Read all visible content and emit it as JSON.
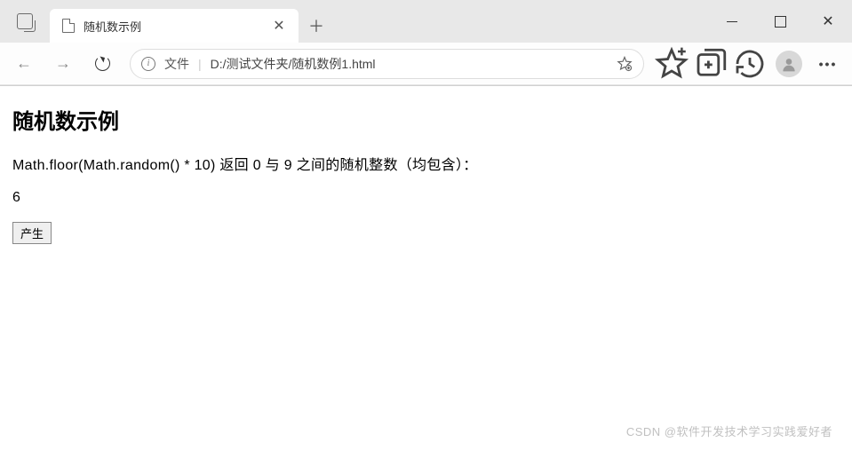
{
  "window": {
    "tab_title": "随机数示例",
    "address_prefix": "文件",
    "url": "D:/测试文件夹/随机数例1.html"
  },
  "page": {
    "heading": "随机数示例",
    "description": "Math.floor(Math.random() * 10) 返回 0 与 9 之间的随机整数（均包含）：",
    "result": "6",
    "button_label": "产生"
  },
  "icons": {
    "back": "←",
    "forward": "→",
    "close_tab": "✕",
    "new_tab": "＋",
    "win_close": "✕",
    "more": "•••",
    "info": "i"
  },
  "watermark": "CSDN @软件开发技术学习实践爱好者"
}
